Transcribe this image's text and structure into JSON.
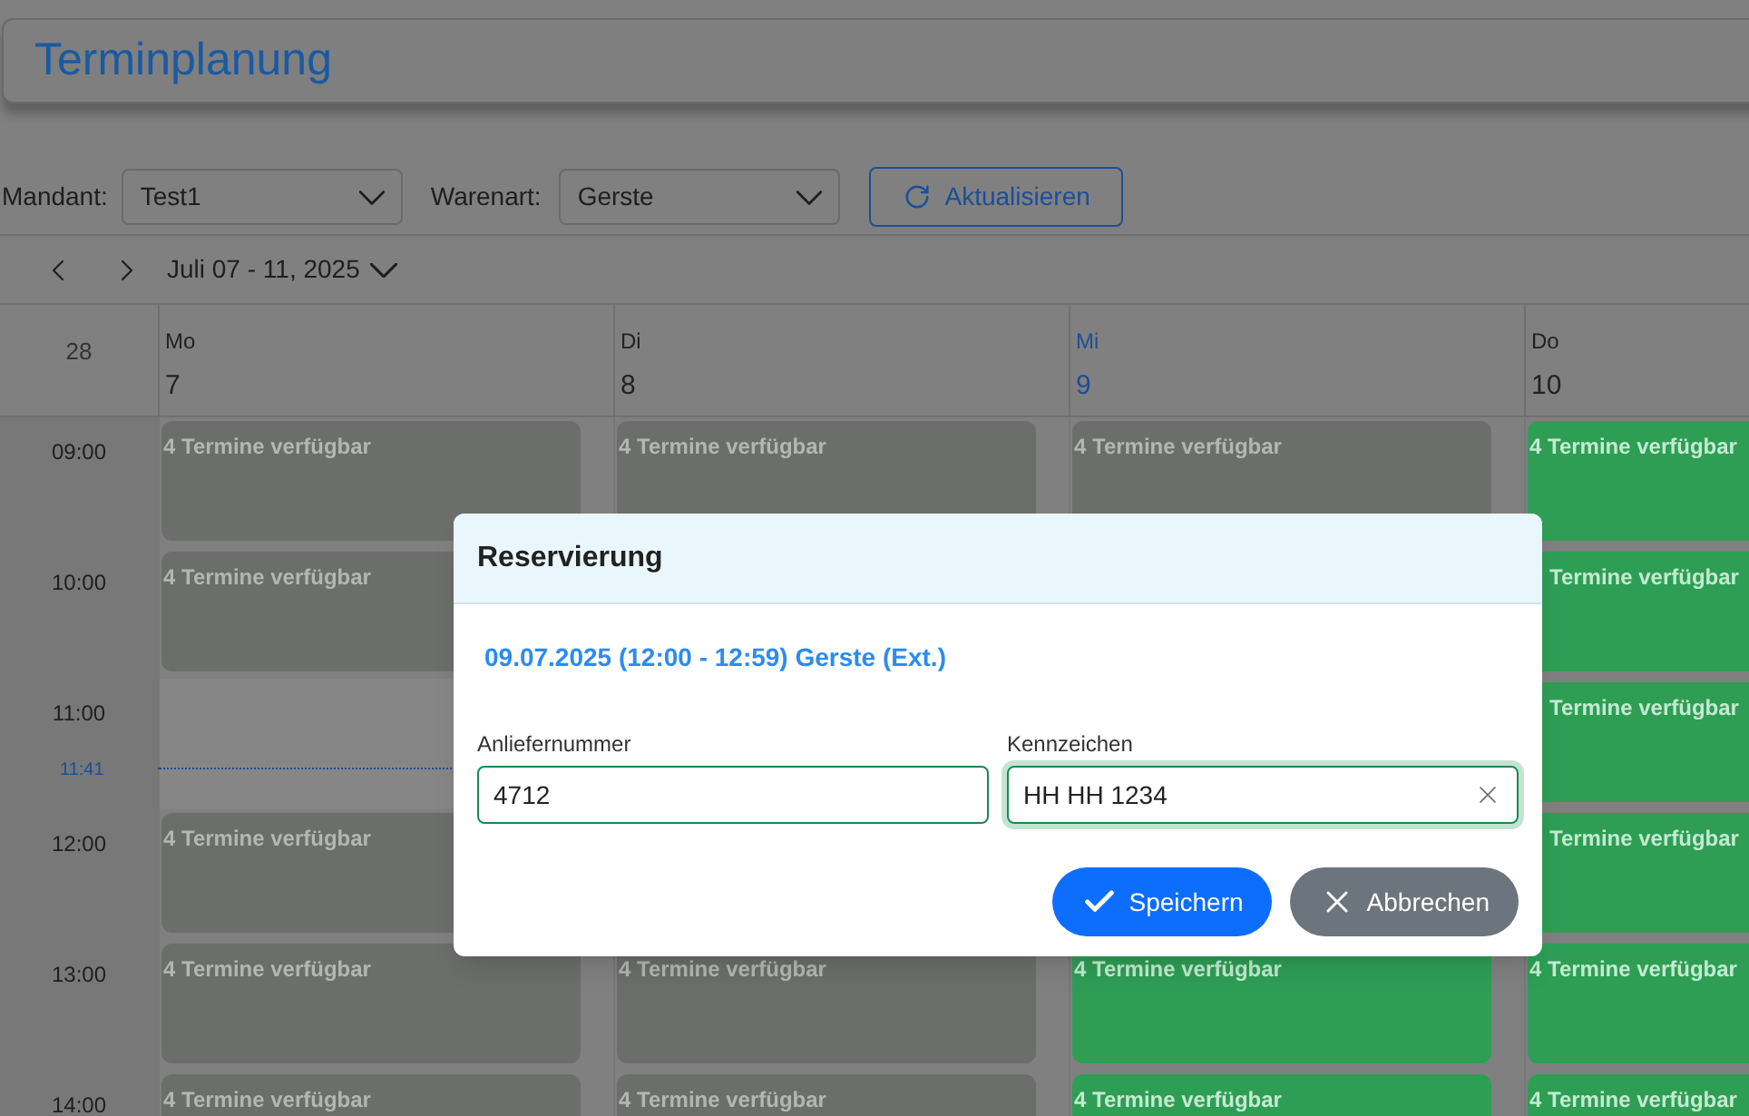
{
  "header": {
    "title": "Terminplanung"
  },
  "toolbar": {
    "mandant": {
      "label": "Mandant:",
      "value": "Test1"
    },
    "warenart": {
      "label": "Warenart:",
      "value": "Gerste"
    },
    "refresh_button": "Aktualisieren"
  },
  "calendar": {
    "range": "Juli 07 - 11, 2025",
    "week_number": "28",
    "current_time": "11:41",
    "days": [
      {
        "short": "Mo",
        "date": "7",
        "today": false
      },
      {
        "short": "Di",
        "date": "8",
        "today": false
      },
      {
        "short": "Mi",
        "date": "9",
        "today": true
      },
      {
        "short": "Do",
        "date": "10",
        "today": false
      }
    ],
    "rows": [
      {
        "time": "09:00",
        "cells": [
          {
            "kind": "slot",
            "label": "4 Termine verfügbar",
            "available": false
          },
          {
            "kind": "slot",
            "label": "4 Termine verfügbar",
            "available": false
          },
          {
            "kind": "slot",
            "label": "4 Termine verfügbar",
            "available": false
          },
          {
            "kind": "slot",
            "label": "4 Termine verfügbar",
            "available": true
          }
        ]
      },
      {
        "time": "10:00",
        "cells": [
          {
            "kind": "slot",
            "label": "4 Termine verfügbar",
            "available": false
          },
          {
            "kind": "hidden"
          },
          {
            "kind": "hidden"
          },
          {
            "kind": "slot",
            "label": "Termine verfügbar",
            "available": true,
            "partly_covered": true
          }
        ]
      },
      {
        "time": "11:00",
        "cells": [
          {
            "kind": "empty"
          },
          {
            "kind": "hidden"
          },
          {
            "kind": "hidden"
          },
          {
            "kind": "slot",
            "label": "Termine verfügbar",
            "available": true,
            "partly_covered": true
          }
        ]
      },
      {
        "time": "12:00",
        "cells": [
          {
            "kind": "slot",
            "label": "4 Termine verfügbar",
            "available": false
          },
          {
            "kind": "hidden"
          },
          {
            "kind": "hidden"
          },
          {
            "kind": "slot",
            "label": "Termine verfügbar",
            "available": true,
            "partly_covered": true
          }
        ]
      },
      {
        "time": "13:00",
        "cells": [
          {
            "kind": "slot",
            "label": "4 Termine verfügbar",
            "available": false
          },
          {
            "kind": "slot",
            "label": "4 Termine verfügbar",
            "available": false
          },
          {
            "kind": "slot",
            "label": "4 Termine verfügbar",
            "available": true
          },
          {
            "kind": "slot",
            "label": "4 Termine verfügbar",
            "available": true
          }
        ]
      },
      {
        "time": "14:00",
        "cells": [
          {
            "kind": "slot",
            "label": "4 Termine verfügbar",
            "available": false
          },
          {
            "kind": "slot",
            "label": "4 Termine verfügbar",
            "available": false
          },
          {
            "kind": "slot",
            "label": "4 Termine verfügbar",
            "available": true
          },
          {
            "kind": "slot",
            "label": "4 Termine verfügbar",
            "available": true
          }
        ]
      }
    ]
  },
  "dialog": {
    "title": "Reservierung",
    "subtitle": "09.07.2025 (12:00 - 12:59) Gerste (Ext.)",
    "fields": [
      {
        "label": "Anliefernummer",
        "value": "4712",
        "focused": false
      },
      {
        "label": "Kennzeichen",
        "value": "HH HH 1234",
        "focused": true
      }
    ],
    "buttons": [
      {
        "kind": "primary",
        "label": "Speichern"
      },
      {
        "kind": "secondary",
        "label": "Abbrechen"
      }
    ]
  }
}
